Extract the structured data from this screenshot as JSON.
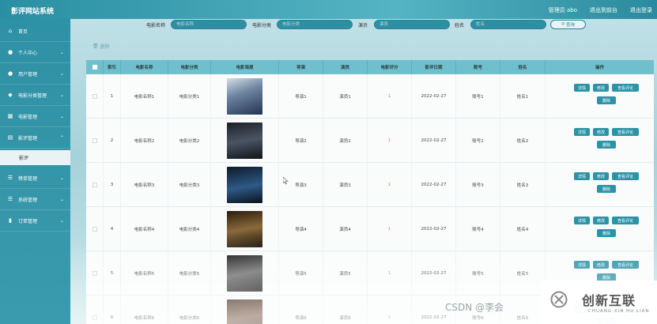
{
  "header": {
    "brand": "影评网站系统",
    "user": "管理员 abo",
    "goto_front": "退出到前台",
    "logout": "退出登录"
  },
  "sidebar": {
    "items": [
      {
        "label": "首页",
        "icon": "home-icon",
        "has_chevron": false
      },
      {
        "label": "个人中心",
        "icon": "user-icon",
        "has_chevron": true
      },
      {
        "label": "用户管理",
        "icon": "user-icon",
        "has_chevron": true
      },
      {
        "label": "电影分类管理",
        "icon": "location-icon",
        "has_chevron": true
      },
      {
        "label": "电影管理",
        "icon": "film-icon",
        "has_chevron": true
      },
      {
        "label": "影评管理",
        "icon": "review-icon",
        "has_chevron": true
      },
      {
        "label": "榜单管理",
        "icon": "list-icon",
        "has_chevron": true
      },
      {
        "label": "系统管理",
        "icon": "list-icon",
        "has_chevron": true
      },
      {
        "label": "订单管理",
        "icon": "chart-icon",
        "has_chevron": true
      }
    ],
    "sub_item": "影评"
  },
  "search": {
    "name_label": "电影名称",
    "name_placeholder": "电影名称",
    "category_label": "电影分类",
    "category_placeholder": "电影分类",
    "actor_label": "演员",
    "actor_placeholder": "演员",
    "person_label": "姓名",
    "person_placeholder": "姓名",
    "button": "查询"
  },
  "toolbar": {
    "delete_label": "删除"
  },
  "table": {
    "headers": [
      "索引",
      "电影名称",
      "电影分类",
      "电影海报",
      "导演",
      "演员",
      "电影评分",
      "影评日期",
      "账号",
      "姓名",
      "操作"
    ],
    "rows": [
      {
        "index": "1",
        "name": "电影名称1",
        "category": "电影分类1",
        "director": "导演1",
        "actor": "演员1",
        "score": "1",
        "date": "2022-02-27",
        "account": "账号1",
        "person": "姓名1"
      },
      {
        "index": "2",
        "name": "电影名称2",
        "category": "电影分类2",
        "director": "导演2",
        "actor": "演员2",
        "score": "1",
        "date": "2022-02-27",
        "account": "账号2",
        "person": "姓名2"
      },
      {
        "index": "3",
        "name": "电影名称3",
        "category": "电影分类3",
        "director": "导演3",
        "actor": "演员3",
        "score": "1",
        "date": "2022-02-27",
        "account": "账号3",
        "person": "姓名3"
      },
      {
        "index": "4",
        "name": "电影名称4",
        "category": "电影分类4",
        "director": "导演4",
        "actor": "演员4",
        "score": "1",
        "date": "2022-02-27",
        "account": "账号4",
        "person": "姓名4"
      },
      {
        "index": "5",
        "name": "电影名称5",
        "category": "电影分类5",
        "director": "导演5",
        "actor": "演员5",
        "score": "1",
        "date": "2022-02-27",
        "account": "账号5",
        "person": "姓名5"
      },
      {
        "index": "6",
        "name": "电影名称6",
        "category": "电影分类6",
        "director": "导演6",
        "actor": "演员6",
        "score": "1",
        "date": "2022-02-27",
        "account": "账号6",
        "person": "姓名6"
      }
    ],
    "actions": {
      "detail": "详情",
      "edit": "修改",
      "view_review": "查看评论",
      "delete": "删除"
    }
  },
  "watermark": {
    "csdn": "CSDN @李会",
    "brand_cn": "创新互联",
    "brand_en": "CHUANG XIN HU LIAN"
  },
  "colors": {
    "accent": "#2c93a6",
    "header_bg": "#6fc0cc",
    "score": "#d9823b"
  }
}
